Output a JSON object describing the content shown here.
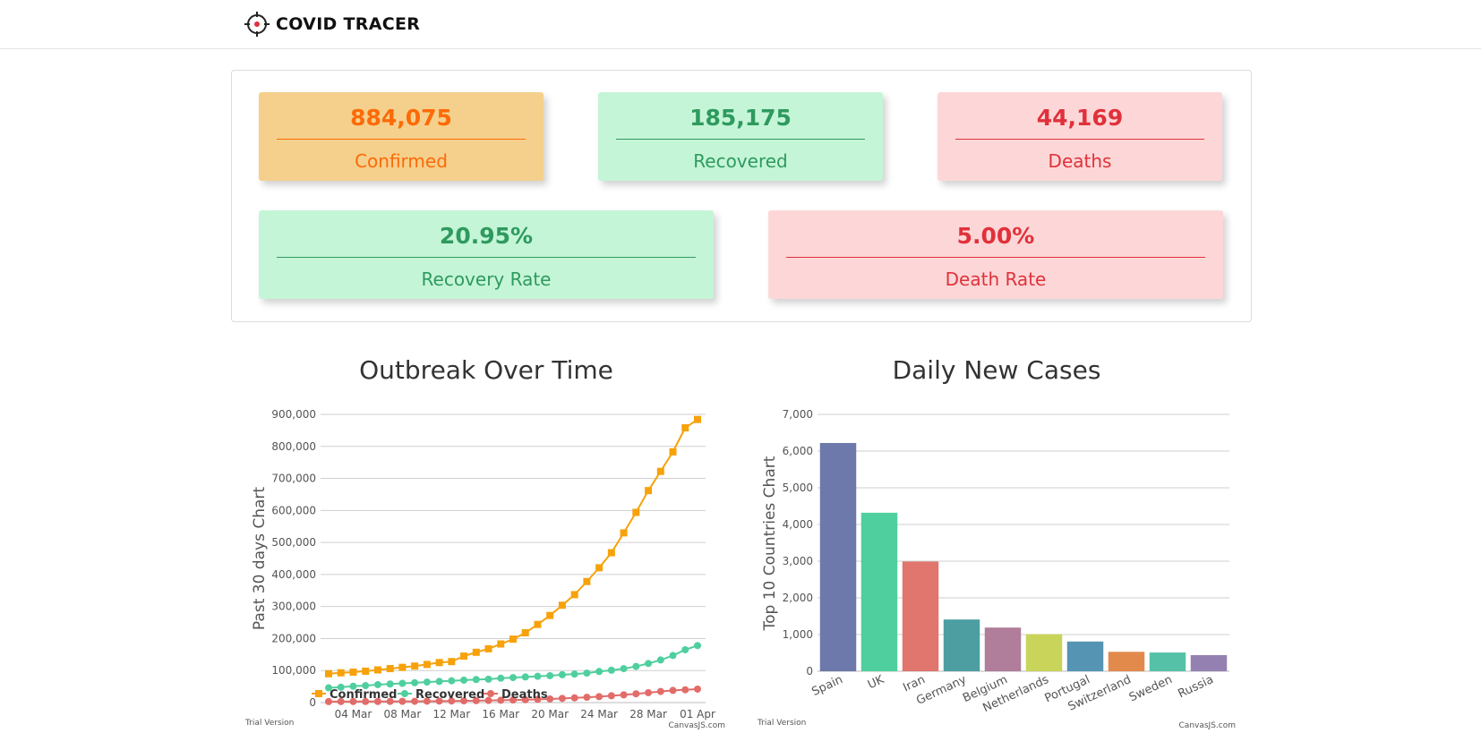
{
  "header": {
    "brand_name": "COVID TRACER",
    "brand_icon": "crosshair-target-icon"
  },
  "stats": {
    "confirmed": {
      "value": "884,075",
      "label": "Confirmed",
      "color": "#fd6a08",
      "bg": "#f5d08c"
    },
    "recovered": {
      "value": "185,175",
      "label": "Recovered",
      "color": "#2e9a5e",
      "bg": "#c5f5d7"
    },
    "deaths": {
      "value": "44,169",
      "label": "Deaths",
      "color": "#e0313b",
      "bg": "#fdd7d7"
    },
    "recovery_rate": {
      "value": "20.95%",
      "label": "Recovery Rate",
      "color": "#2e9a5e",
      "bg": "#c5f5d7"
    },
    "death_rate": {
      "value": "5.00%",
      "label": "Death Rate",
      "color": "#e0313b",
      "bg": "#fdd7d7"
    }
  },
  "chart_data": [
    {
      "type": "line",
      "title": "Outbreak Over Time",
      "ylabel": "Past 30 days Chart",
      "xlabel": "",
      "x": [
        "02 Mar",
        "03 Mar",
        "04 Mar",
        "05 Mar",
        "06 Mar",
        "07 Mar",
        "08 Mar",
        "09 Mar",
        "10 Mar",
        "11 Mar",
        "12 Mar",
        "13 Mar",
        "14 Mar",
        "15 Mar",
        "16 Mar",
        "17 Mar",
        "18 Mar",
        "19 Mar",
        "20 Mar",
        "21 Mar",
        "22 Mar",
        "23 Mar",
        "24 Mar",
        "25 Mar",
        "26 Mar",
        "27 Mar",
        "28 Mar",
        "29 Mar",
        "30 Mar",
        "31 Mar",
        "01 Apr"
      ],
      "x_tick_labels": [
        "04 Mar",
        "08 Mar",
        "12 Mar",
        "16 Mar",
        "20 Mar",
        "24 Mar",
        "28 Mar",
        "01 Apr"
      ],
      "ylim": [
        0,
        900000
      ],
      "y_ticks": [
        0,
        100000,
        200000,
        300000,
        400000,
        500000,
        600000,
        700000,
        800000,
        900000
      ],
      "y_tick_labels": [
        "0",
        "100,000",
        "200,000",
        "300,000",
        "400,000",
        "500,000",
        "600,000",
        "700,000",
        "800,000",
        "900,000"
      ],
      "grid": "horizontal",
      "legend_position": "bottom-left",
      "series": [
        {
          "name": "Confirmed",
          "color": "#f7a20a",
          "marker": "square",
          "values": [
            90000,
            93000,
            95000,
            98000,
            102000,
            106000,
            110000,
            114000,
            119000,
            125000,
            128000,
            145000,
            157000,
            168000,
            183000,
            198000,
            218000,
            244000,
            272000,
            304000,
            337000,
            378000,
            421000,
            468000,
            530000,
            594000,
            662000,
            722000,
            783000,
            858000,
            884075
          ]
        },
        {
          "name": "Recovered",
          "color": "#4fcf9e",
          "marker": "circle",
          "values": [
            46000,
            48000,
            51000,
            53000,
            56000,
            58000,
            60000,
            62000,
            64000,
            66000,
            68000,
            70000,
            72000,
            73000,
            76000,
            78000,
            80000,
            82000,
            84000,
            87000,
            89000,
            92000,
            97000,
            101000,
            106000,
            113000,
            122000,
            133000,
            147000,
            165000,
            178000
          ]
        },
        {
          "name": "Deaths",
          "color": "#e26c69",
          "marker": "circle",
          "values": [
            3100,
            3200,
            3300,
            3400,
            3500,
            3600,
            3800,
            4000,
            4300,
            4600,
            5000,
            5400,
            5800,
            6500,
            7200,
            8000,
            8900,
            10000,
            11300,
            13000,
            14700,
            16500,
            18500,
            21200,
            24100,
            27400,
            30900,
            34700,
            38000,
            40000,
            42000
          ]
        }
      ]
    },
    {
      "type": "bar",
      "title": "Daily New Cases",
      "ylabel": "Top 10 Countries Chart",
      "xlabel": "",
      "categories": [
        "Spain",
        "UK",
        "Iran",
        "Germany",
        "Belgium",
        "Netherlands",
        "Portugal",
        "Switzerland",
        "Sweden",
        "Russia"
      ],
      "values": [
        6220,
        4320,
        2990,
        1410,
        1190,
        1010,
        810,
        530,
        510,
        440
      ],
      "colors": [
        "#6d79aa",
        "#4fcf9e",
        "#e0766d",
        "#4c9ea1",
        "#b07d9a",
        "#c8d45a",
        "#5594b2",
        "#e28a4c",
        "#55c2a8",
        "#9481b1"
      ],
      "ylim": [
        0,
        7000
      ],
      "y_ticks": [
        0,
        1000,
        2000,
        3000,
        4000,
        5000,
        6000,
        7000
      ],
      "y_tick_labels": [
        "0",
        "1,000",
        "2,000",
        "3,000",
        "4,000",
        "5,000",
        "6,000",
        "7,000"
      ],
      "grid": "horizontal"
    }
  ],
  "watermarks": {
    "trial": "Trial Version",
    "credit": "CanvasJS.com"
  }
}
